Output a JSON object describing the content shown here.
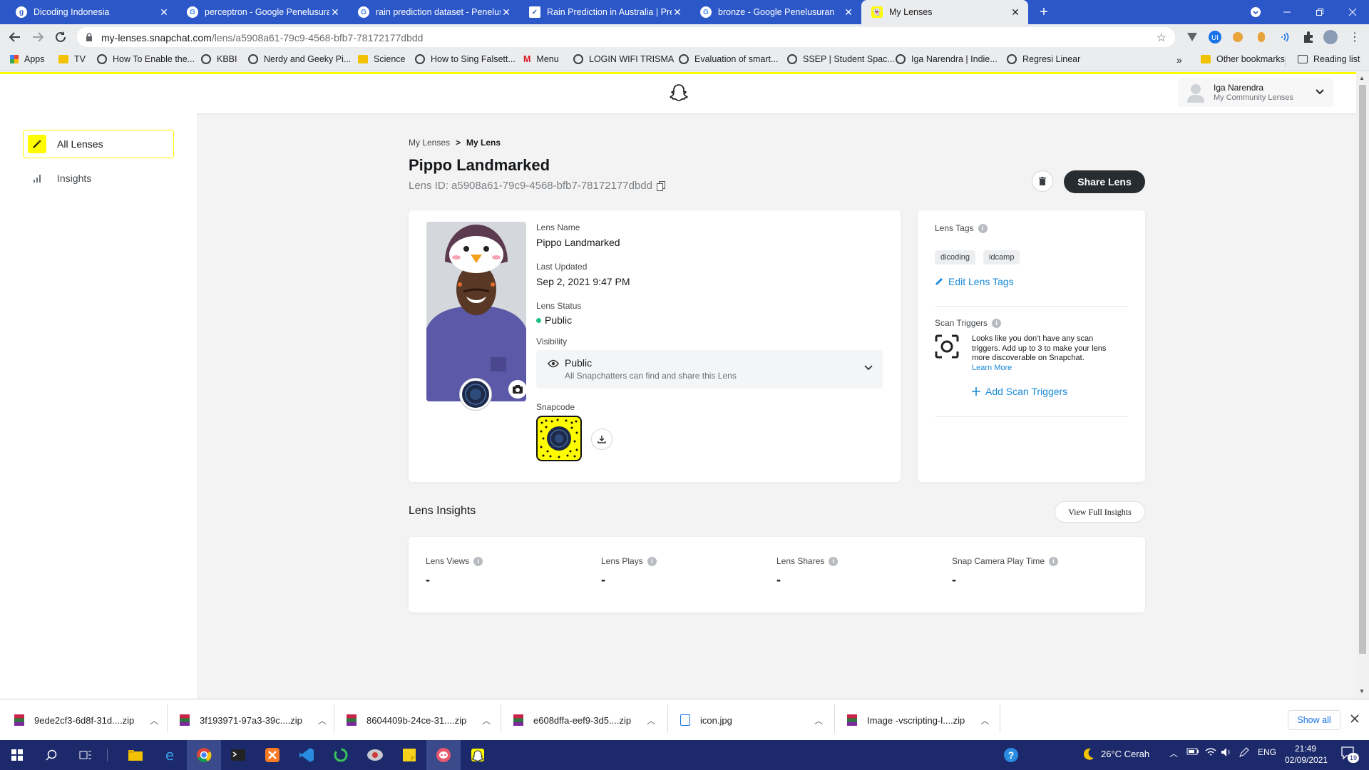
{
  "browser": {
    "tabs": [
      {
        "title": "Dicoding Indonesia",
        "favicon": "dicoding-icon",
        "active": false
      },
      {
        "title": "perceptron - Google Penelusuran",
        "favicon": "google-icon",
        "active": false
      },
      {
        "title": "rain prediction dataset - Penelusuran",
        "favicon": "google-icon",
        "active": false
      },
      {
        "title": "Rain Prediction in Australia | Pred",
        "favicon": "page-icon",
        "active": false
      },
      {
        "title": "bronze - Google Penelusuran",
        "favicon": "google-icon",
        "active": false
      },
      {
        "title": "My Lenses",
        "favicon": "snapchat-icon",
        "active": true
      }
    ],
    "url_host": "my-lenses.snapchat.com",
    "url_path": "/lens/a5908a61-79c9-4568-bfb7-78172177dbdd",
    "bookmarks": [
      "Apps",
      "TV",
      "How To Enable the...",
      "KBBI",
      "Nerdy and Geeky Pi...",
      "Science",
      "How to Sing Falsett...",
      "Menu",
      "LOGIN WIFI TRISMA",
      "Evaluation of smart...",
      "SSEP | Student Spac...",
      "Iga Narendra | Indie...",
      "Regresi Linear"
    ],
    "other_bookmarks": "Other bookmarks",
    "reading_list": "Reading list",
    "more": "»"
  },
  "header": {
    "user_name": "Iga Narendra",
    "user_subtitle": "My Community Lenses"
  },
  "sidebar": {
    "items": [
      {
        "label": "All Lenses",
        "active": true
      },
      {
        "label": "Insights",
        "active": false
      }
    ]
  },
  "breadcrumb": {
    "parent": "My Lenses",
    "separator": ">",
    "current": "My Lens"
  },
  "lens": {
    "title": "Pippo Landmarked",
    "id_label": "Lens ID: a5908a61-79c9-4568-bfb7-78172177dbdd",
    "share_button": "Share Lens",
    "name_label": "Lens Name",
    "name_value": "Pippo Landmarked",
    "updated_label": "Last Updated",
    "updated_value": "Sep 2, 2021 9:47 PM",
    "status_label": "Lens Status",
    "status_value": "Public",
    "visibility_label": "Visibility",
    "visibility_value": "Public",
    "visibility_desc": "All Snapchatters can find and share this Lens",
    "snapcode_label": "Snapcode"
  },
  "tags_card": {
    "title": "Lens Tags",
    "tags": [
      "dicoding",
      "idcamp"
    ],
    "edit_link": "Edit Lens Tags",
    "scan_title": "Scan Triggers",
    "scan_desc": "Looks like you don't have any scan triggers. Add up to 3 to make your lens more discoverable on Snapchat.",
    "learn_more": "Learn More",
    "add_link": "Add Scan Triggers"
  },
  "insights": {
    "title": "Lens Insights",
    "view_full": "View Full Insights",
    "metrics": [
      {
        "label": "Lens Views",
        "value": "-"
      },
      {
        "label": "Lens Plays",
        "value": "-"
      },
      {
        "label": "Lens Shares",
        "value": "-"
      },
      {
        "label": "Snap Camera Play Time",
        "value": "-"
      }
    ]
  },
  "downloads": {
    "files": [
      "9ede2cf3-6d8f-31d....zip",
      "3f193971-97a3-39c....zip",
      "8604409b-24ce-31....zip",
      "e608dffa-eef9-3d5....zip",
      "icon.jpg",
      "Image -vscripting-l....zip"
    ],
    "show_all": "Show all"
  },
  "taskbar": {
    "weather": "26°C  Cerah",
    "lang": "ENG",
    "time": "21:49",
    "date": "02/09/2021",
    "notifications": "19"
  },
  "colors": {
    "snap_yellow": "#fffc00",
    "chrome_blue": "#2b57c8",
    "link_blue": "#1a8ad9",
    "dark_button": "#262c30",
    "status_green": "#20c183"
  }
}
